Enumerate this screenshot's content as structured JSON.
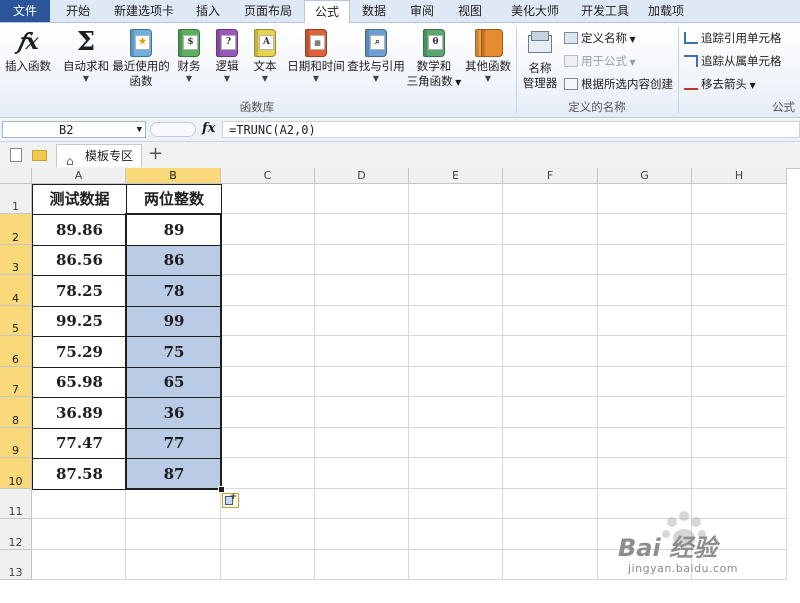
{
  "tabs": [
    "文件",
    "开始",
    "新建选项卡",
    "插入",
    "页面布局",
    "公式",
    "数据",
    "审阅",
    "视图",
    "美化大师",
    "开发工具",
    "加载项"
  ],
  "active_tab": "公式",
  "ribbon": {
    "insert_function": "插入函数",
    "autosum": "自动求和",
    "recent": [
      "最近使用的",
      "函数"
    ],
    "financial": "财务",
    "logical": "逻辑",
    "text": "文本",
    "datetime": "日期和时间",
    "lookup": "查找与引用",
    "math": [
      "数学和",
      "三角函数"
    ],
    "more": "其他函数",
    "group_library": "函数库",
    "name_manager": [
      "名称",
      "管理器"
    ],
    "define_name": "定义名称",
    "use_in_formula": "用于公式",
    "create_from_selection": "根据所选内容创建",
    "group_names": "定义的名称",
    "trace_precedents": "追踪引用单元格",
    "trace_dependents": "追踪从属单元格",
    "remove_arrows": "移去箭头",
    "group_audit": "公式"
  },
  "formula_bar": {
    "name_box": "B2",
    "fx": "fx",
    "formula": "=TRUNC(A2,0)"
  },
  "workbook_tab": "模板专区",
  "columns": [
    "A",
    "B",
    "C",
    "D",
    "E",
    "F",
    "G",
    "H"
  ],
  "rows": [
    "1",
    "2",
    "3",
    "4",
    "5",
    "6",
    "7",
    "8",
    "9",
    "10",
    "11",
    "12",
    "13"
  ],
  "table": {
    "headers": [
      "测试数据",
      "两位整数"
    ],
    "data": [
      [
        "89.86",
        "89"
      ],
      [
        "86.56",
        "86"
      ],
      [
        "78.25",
        "78"
      ],
      [
        "99.25",
        "99"
      ],
      [
        "75.29",
        "75"
      ],
      [
        "65.98",
        "65"
      ],
      [
        "36.89",
        "36"
      ],
      [
        "77.47",
        "77"
      ],
      [
        "87.58",
        "87"
      ]
    ]
  },
  "watermark": {
    "brand": "Bai 经验",
    "url": "jingyan.baidu.com"
  },
  "colors": {
    "file_tab": "#2a5699",
    "selected_header": "#f9d979",
    "selection_fill": "#b9cbe5"
  }
}
